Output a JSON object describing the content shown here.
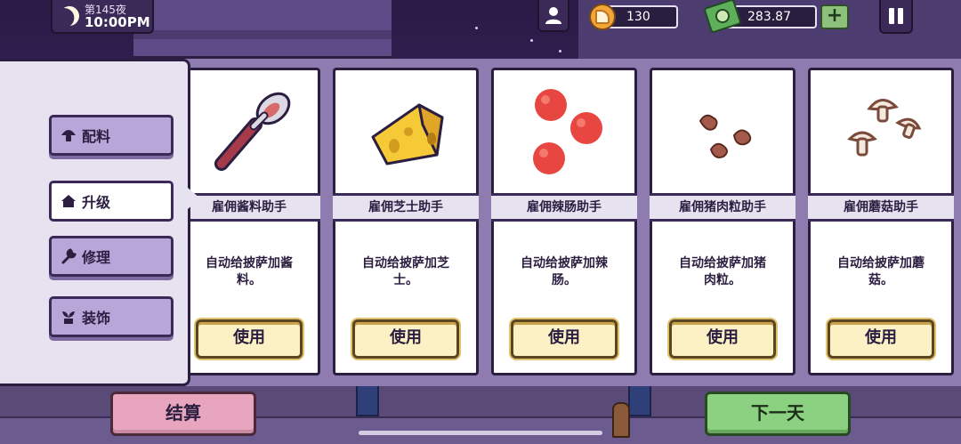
{
  "hud": {
    "night_label": "第145夜",
    "time": "10:00PM",
    "coins": "130",
    "cash": "283.87",
    "add_cash_label": "+"
  },
  "sidebar": {
    "items": [
      {
        "label": "配料",
        "icon": "mushroom-icon"
      },
      {
        "label": "升级",
        "icon": "house-icon"
      },
      {
        "label": "修理",
        "icon": "wrench-icon"
      },
      {
        "label": "装饰",
        "icon": "plant-icon"
      }
    ],
    "active_index": 1
  },
  "cards": [
    {
      "title": "雇佣酱料助手",
      "desc_line1": "自动给披萨加酱",
      "desc_line2": "料。",
      "button": "使用",
      "icon": "sauce-spoon-icon"
    },
    {
      "title": "雇佣芝士助手",
      "desc_line1": "自动给披萨加芝",
      "desc_line2": "士。",
      "button": "使用",
      "icon": "cheese-icon"
    },
    {
      "title": "雇佣辣肠助手",
      "desc_line1": "自动给披萨加辣",
      "desc_line2": "肠。",
      "button": "使用",
      "icon": "pepperoni-icon"
    },
    {
      "title": "雇佣猪肉粒助手",
      "desc_line1": "自动给披萨加猪",
      "desc_line2": "肉粒。",
      "button": "使用",
      "icon": "sausage-bits-icon"
    },
    {
      "title": "雇佣蘑菇助手",
      "desc_line1": "自动给披萨加蘑",
      "desc_line2": "菇。",
      "button": "使用",
      "icon": "mushrooms-icon"
    }
  ],
  "bottom": {
    "settle_label": "结算",
    "next_day_label": "下一天"
  },
  "colors": {
    "panel": "#8e7cb0",
    "sidebar_bg": "#e6e2f0",
    "settle": "#e7a6bd",
    "next_day": "#8cd081",
    "use_button": "#fbf1c4"
  }
}
